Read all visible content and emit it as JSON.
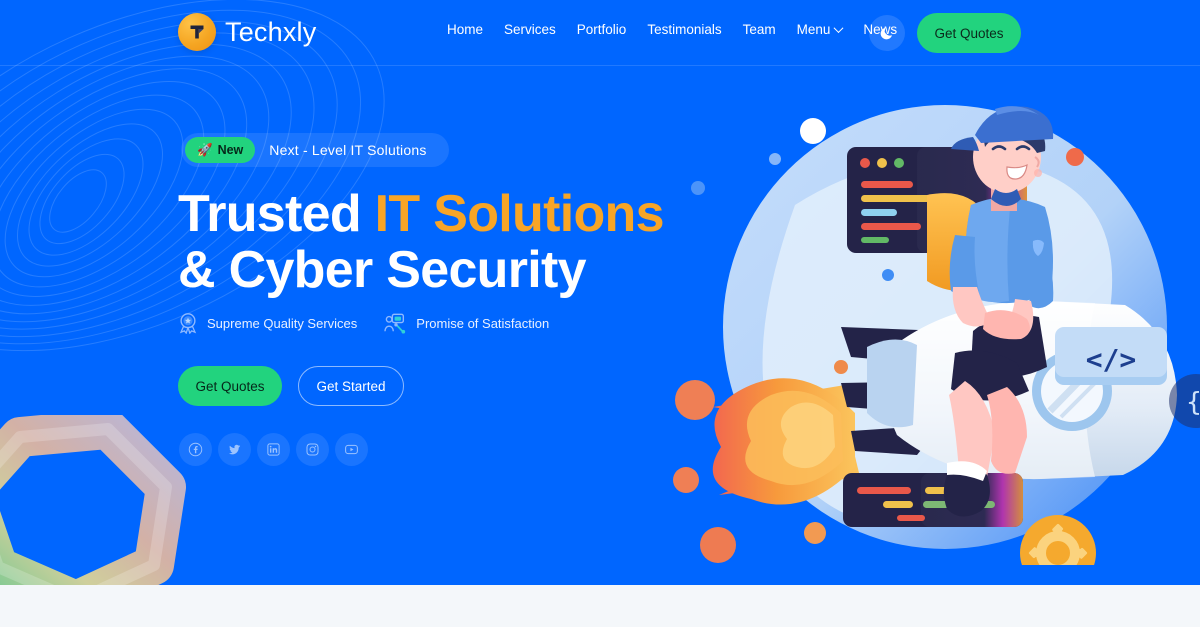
{
  "brand": {
    "name": "Techxly",
    "logo_icon": "techxly-logo-icon",
    "logo_color": "#f5a623"
  },
  "header": {
    "nav": [
      {
        "label": "Home",
        "icon": null
      },
      {
        "label": "Services",
        "icon": null
      },
      {
        "label": "Portfolio",
        "icon": null
      },
      {
        "label": "Testimonials",
        "icon": null
      },
      {
        "label": "Team",
        "icon": null
      },
      {
        "label": "Menu",
        "icon": "chevron-down-icon"
      },
      {
        "label": "News",
        "icon": null
      }
    ],
    "dark_mode_icon": "moon-icon",
    "cta_label": "Get Quotes",
    "cta_color": "#22d37e"
  },
  "hero": {
    "badge": {
      "new_label": "New",
      "new_icon": "rocket-icon",
      "text": "Next - Level IT Solutions"
    },
    "headline_line1_a": "Trusted ",
    "headline_line1_b": "IT Solutions",
    "headline_line2": "& Cyber Security",
    "accent_color": "#f8a526",
    "background_color": "#0066ff",
    "features": [
      {
        "label": "Supreme Quality Services",
        "icon": "quality-badge-icon"
      },
      {
        "label": "Promise of Satisfaction",
        "icon": "support-agent-icon"
      }
    ],
    "buttons": [
      {
        "label": "Get Quotes",
        "style": "solid"
      },
      {
        "label": "Get Started",
        "style": "outline"
      }
    ],
    "socials": [
      {
        "name": "facebook-icon"
      },
      {
        "name": "twitter-icon"
      },
      {
        "name": "linkedin-icon"
      },
      {
        "name": "instagram-icon"
      },
      {
        "name": "youtube-icon"
      }
    ],
    "illustration": {
      "name": "developer-on-rocket-illustration",
      "code_badge": "</>",
      "brace_badge": "{",
      "gear_icon": "gear-icon"
    }
  }
}
